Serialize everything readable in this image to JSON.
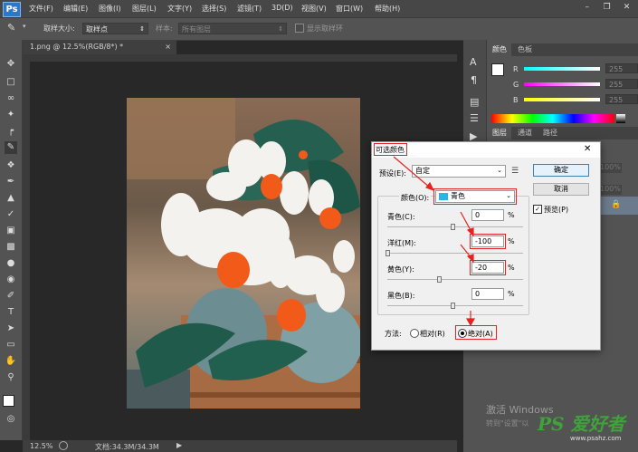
{
  "app": {
    "logo": "Ps",
    "menus": [
      "文件(F)",
      "编辑(E)",
      "图像(I)",
      "图层(L)",
      "文字(Y)",
      "选择(S)",
      "滤镜(T)",
      "3D(D)",
      "视图(V)",
      "窗口(W)",
      "帮助(H)"
    ]
  },
  "options": {
    "sample_size_label": "取样大小:",
    "sample_size_value": "取样点",
    "sample_label": "样本:",
    "sample_value": "所有图层",
    "show_ring": "显示取样环"
  },
  "document": {
    "tab_title": "1.png @ 12.5%(RGB/8*) *",
    "zoom": "12.5%",
    "doc_info": "文档:34.3M/34.3M"
  },
  "color_panel": {
    "tabs": [
      "颜色",
      "色板"
    ],
    "rows": [
      {
        "label": "R",
        "value": "255"
      },
      {
        "label": "G",
        "value": "255"
      },
      {
        "label": "B",
        "value": "255"
      }
    ]
  },
  "layers_panel": {
    "tabs": [
      "图层",
      "通道",
      "路径"
    ],
    "opacity_value": "100%",
    "fill_value": "100%"
  },
  "dialog": {
    "title": "可选颜色",
    "preset_label": "预设(E):",
    "preset_value": "自定",
    "colors_label": "颜色(O):",
    "colors_value": "青色",
    "sliders": [
      {
        "label": "青色(C):",
        "value": "0",
        "pct": 0.5
      },
      {
        "label": "洋红(M):",
        "value": "-100",
        "pct": 0.0
      },
      {
        "label": "黄色(Y):",
        "value": "-20",
        "pct": 0.4
      },
      {
        "label": "黑色(B):",
        "value": "0",
        "pct": 0.5
      }
    ],
    "percent": "%",
    "ok": "确定",
    "cancel": "取消",
    "preview_label": "预览(P)",
    "method_label": "方法:",
    "relative": "相对(R)",
    "absolute": "绝对(A)"
  },
  "watermark": {
    "activate_line1": "激活 Windows",
    "activate_line2": "转到\"设置\"以",
    "site_logo": "PS 爱好者",
    "site_url": "www.psahz.com"
  }
}
